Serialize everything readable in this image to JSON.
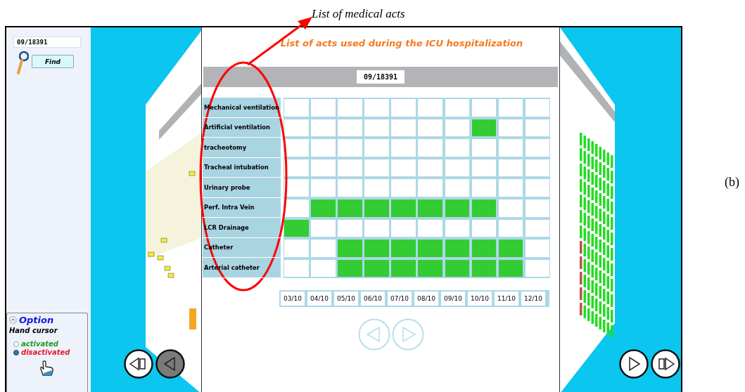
{
  "caption": "List of medical acts",
  "figure_label": "(b)",
  "search": {
    "value": "09/18391",
    "button": "Find"
  },
  "options": {
    "title": "Option",
    "subtitle": "Hand cursor",
    "choices": [
      {
        "label": "activated",
        "selected": false,
        "color": "#1e9a1e"
      },
      {
        "label": "disactivated",
        "selected": true,
        "color": "#e8182a"
      }
    ]
  },
  "panel": {
    "title": "List of acts used during the ICU hospitalization",
    "record_id": "09/18391",
    "acts": [
      {
        "label": "Mechanical ventilation",
        "cells": [
          false,
          false,
          false,
          false,
          false,
          false,
          false,
          false,
          false,
          false
        ]
      },
      {
        "label": "Artificial ventilation",
        "cells": [
          false,
          false,
          false,
          false,
          false,
          false,
          false,
          true,
          false,
          false
        ]
      },
      {
        "label": "tracheotomy",
        "cells": [
          false,
          false,
          false,
          false,
          false,
          false,
          false,
          false,
          false,
          false
        ]
      },
      {
        "label": "Tracheal intubation",
        "cells": [
          false,
          false,
          false,
          false,
          false,
          false,
          false,
          false,
          false,
          false
        ]
      },
      {
        "label": "Urinary probe",
        "cells": [
          false,
          false,
          false,
          false,
          false,
          false,
          false,
          false,
          false,
          false
        ]
      },
      {
        "label": "Perf. Intra Vein",
        "cells": [
          false,
          true,
          true,
          true,
          true,
          true,
          true,
          true,
          false,
          false
        ]
      },
      {
        "label": "LCR Drainage",
        "cells": [
          true,
          false,
          false,
          false,
          false,
          false,
          false,
          false,
          false,
          false
        ]
      },
      {
        "label": "Catheter",
        "cells": [
          false,
          false,
          true,
          true,
          true,
          true,
          true,
          true,
          true,
          false
        ]
      },
      {
        "label": "Arterial catheter",
        "cells": [
          false,
          false,
          true,
          true,
          true,
          true,
          true,
          true,
          true,
          false
        ]
      }
    ],
    "dates": [
      "03/10",
      "04/10",
      "05/10",
      "06/10",
      "07/10",
      "08/10",
      "09/10",
      "10/10",
      "11/10",
      "12/10"
    ]
  }
}
